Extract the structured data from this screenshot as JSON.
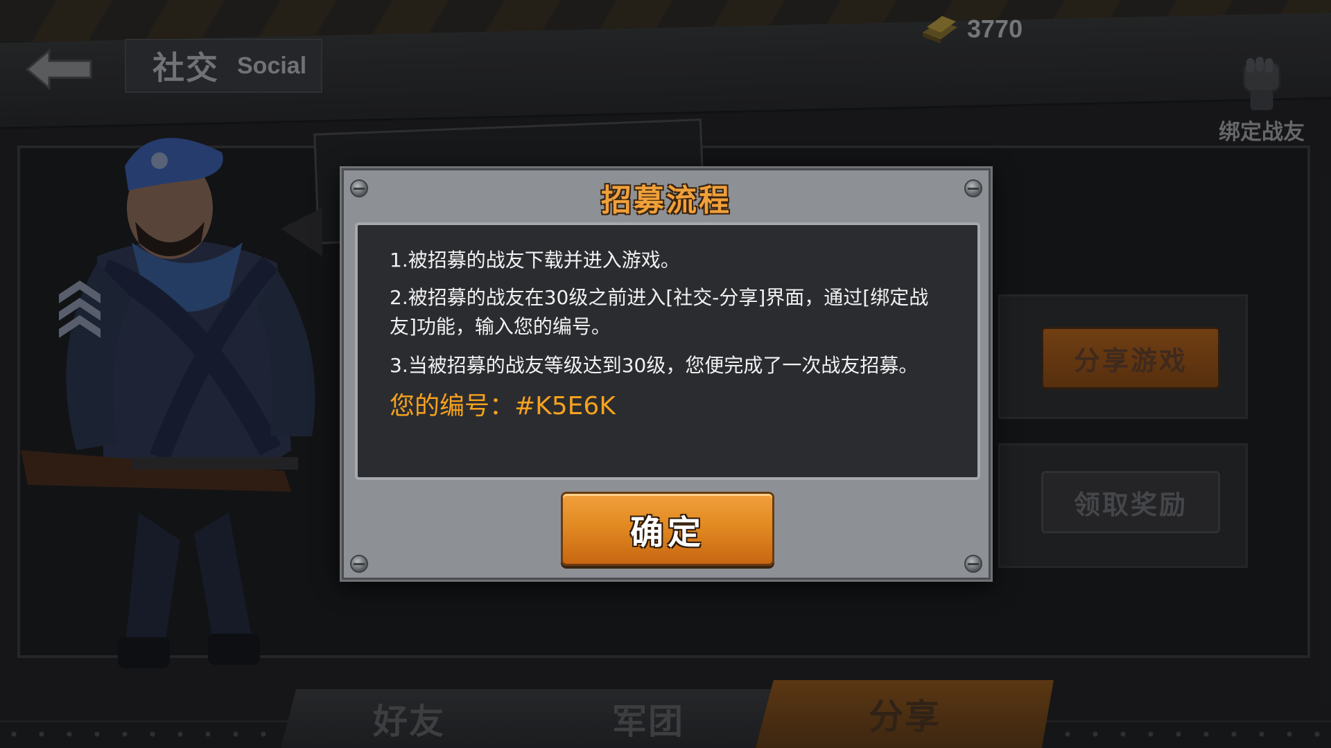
{
  "header": {
    "title_cn": "社交",
    "title_en": "Social",
    "gold": "3770",
    "bind_label": "绑定战友"
  },
  "side_buttons": {
    "share_game": "分享游戏",
    "get_reward": "领取奖励"
  },
  "tabs": [
    {
      "label": "好友",
      "active": false
    },
    {
      "label": "军团",
      "active": false
    },
    {
      "label": "分享",
      "active": true
    }
  ],
  "dialog": {
    "title": "招募流程",
    "steps": [
      "1.被招募的战友下载并进入游戏。",
      "2.被招募的战友在30级之前进入[社交-分享]界面，通过[绑定战友]功能，输入您的编号。",
      "3.当被招募的战友等级达到30级，您便完成了一次战友招募。"
    ],
    "code_line": "您的编号：#K5E6K",
    "confirm_label": "确定"
  },
  "colors": {
    "accent_orange": "#f5a21e",
    "dialog_bg": "#8d9195",
    "panel_bg": "#2b2c30"
  },
  "icons": [
    "back-arrow-icon",
    "gold-bar-icon",
    "fist-icon"
  ]
}
